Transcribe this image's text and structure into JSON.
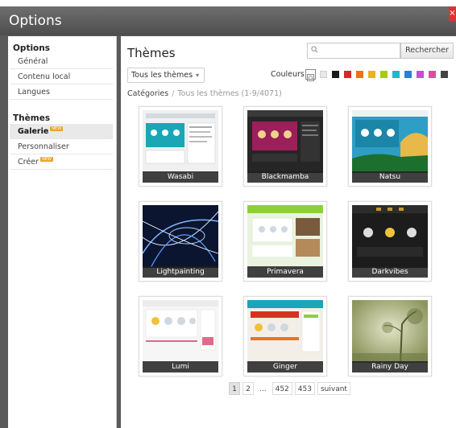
{
  "window": {
    "title": "Options",
    "close_label": "×"
  },
  "sidebar": {
    "section1": "Options",
    "items1": [
      "Général",
      "Contenu local",
      "Langues"
    ],
    "section2": "Thèmes",
    "items2": [
      {
        "label": "Galerie",
        "badge": "NEW",
        "active": true
      },
      {
        "label": "Personnaliser",
        "badge": "",
        "active": false
      },
      {
        "label": "Créer",
        "badge": "NEW",
        "active": false
      }
    ]
  },
  "main": {
    "title": "Thèmes",
    "search": {
      "placeholder": "",
      "value": "",
      "button": "Rechercher"
    },
    "filter": {
      "selected": "Tous les thèmes"
    },
    "colors_label": "Couleurs",
    "swatches": [
      "#e8e8e8",
      "#1a1a1a",
      "#d92626",
      "#e8741c",
      "#e8b31c",
      "#a8c81e",
      "#1eb8c8",
      "#2b7fd9",
      "#c84bd9",
      "#d94fa0",
      "#444444"
    ],
    "breadcrumb": {
      "root": "Catégories",
      "current": "Tous les thèmes (1-9/4071)"
    }
  },
  "themes": [
    {
      "name": "Wasabi",
      "bg": "#e9ecef",
      "accent": "#1aa6b7"
    },
    {
      "name": "Blackmamba",
      "bg": "#2a2a2a",
      "accent": "#9b1f5a"
    },
    {
      "name": "Natsu",
      "bg": "#2e9ec4",
      "accent": "#1d6f2e"
    },
    {
      "name": "Lightpainting",
      "bg": "#0b1530",
      "accent": "#7fb7ff"
    },
    {
      "name": "Primavera",
      "bg": "#e9f3e0",
      "accent": "#8ccf3a"
    },
    {
      "name": "Darkvibes",
      "bg": "#1c1c1c",
      "accent": "#c49a2a"
    },
    {
      "name": "Lumi",
      "bg": "#f4f4f4",
      "accent": "#e06a8a"
    },
    {
      "name": "Ginger",
      "bg": "#f3efe8",
      "accent": "#d6321f"
    },
    {
      "name": "Rainy Day",
      "bg": "#b9bf8e",
      "accent": "#6d7a45"
    }
  ],
  "pagination": {
    "pages": [
      "1",
      "2",
      "...",
      "452",
      "453"
    ],
    "current": "1",
    "next": "suivant"
  }
}
